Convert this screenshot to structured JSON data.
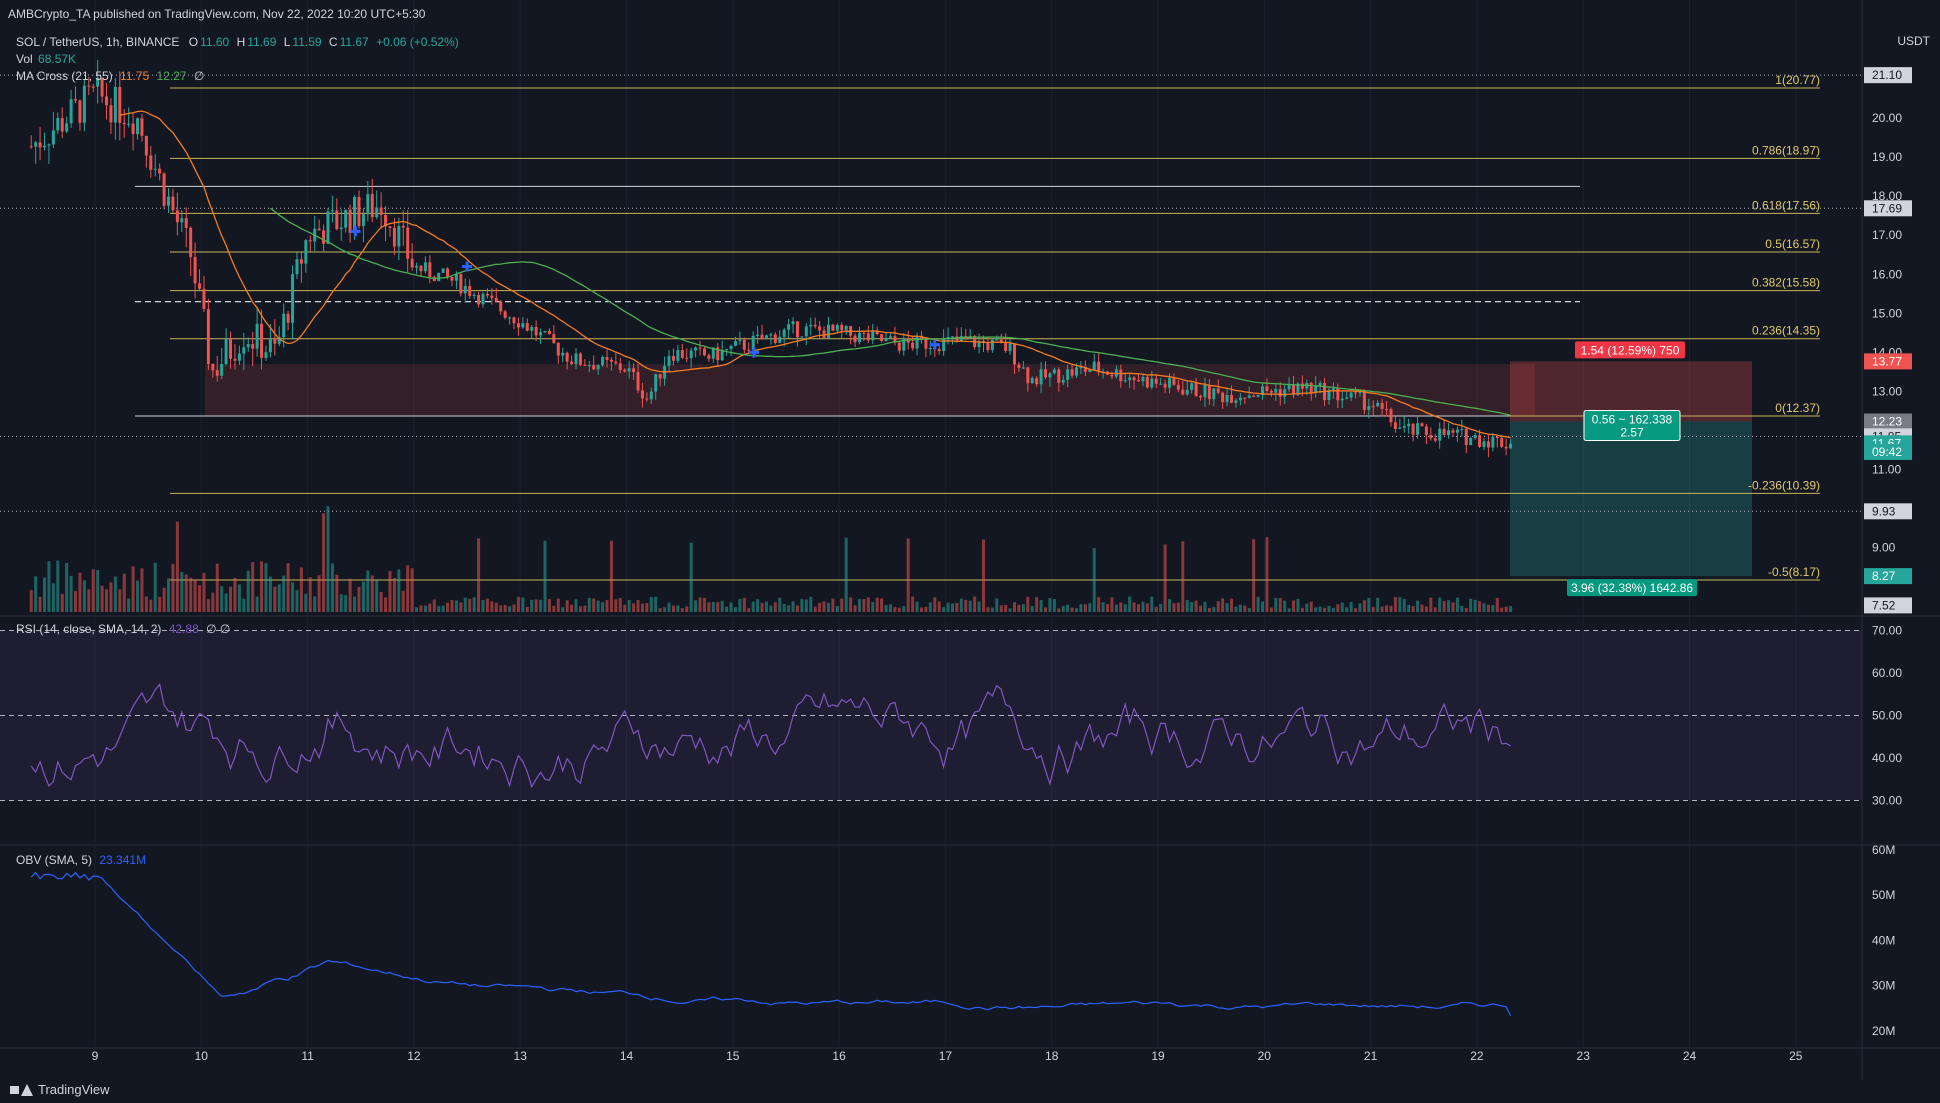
{
  "header": {
    "text": "AMBCrypto_TA published on TradingView.com, Nov 22, 2022 10:20 UTC+5:30"
  },
  "legend": {
    "symbol": "SOL / TetherUS, 1h, BINANCE",
    "o_label": "O",
    "o": "11.60",
    "h_label": "H",
    "h": "11.69",
    "l_label": "L",
    "l": "11.59",
    "c_label": "C",
    "c": "11.67",
    "chg": "+0.06 (+0.52%)",
    "vol_label": "Vol",
    "vol": "68.57K",
    "ma_label": "MA Cross (21, 55)",
    "ma1": "11.75",
    "ma2": "12.27",
    "ma_tail": "∅",
    "rsi_label": "RSI (14, close, SMA, 14, 2)",
    "rsi": "42.88",
    "rsi_tail": "∅ ∅",
    "obv_label": "OBV (SMA, 5)",
    "obv": "23.341M"
  },
  "axis_title": "USDT",
  "footer": {
    "brand": "TradingView"
  },
  "colors": {
    "bg": "#131722",
    "up": "#26a69a",
    "down": "#ef5350",
    "fib": "#c9b458",
    "ma_fast": "#f57c20",
    "ma_slow": "#4caf50",
    "rsi": "#7e57c2",
    "obv": "#2962ff",
    "marker": "#2962ff"
  },
  "chart_data": {
    "type": "candlestick",
    "x_ticks": [
      "9",
      "10",
      "11",
      "12",
      "13",
      "14",
      "15",
      "16",
      "17",
      "18",
      "19",
      "20",
      "21",
      "22",
      "23",
      "24",
      "25"
    ],
    "price_ticks": [
      20.0,
      19.0,
      18.0,
      17.0,
      16.0,
      15.0,
      14.0,
      13.0,
      11.0,
      10.0,
      9.0
    ],
    "price_range": [
      7.3,
      22.0
    ],
    "fib_levels": [
      {
        "ratio": "1",
        "price": 20.77,
        "label": "1(20.77)"
      },
      {
        "ratio": "0.786",
        "price": 18.97,
        "label": "0.786(18.97)"
      },
      {
        "ratio": "0.618",
        "price": 17.56,
        "label": "0.618(17.56)"
      },
      {
        "ratio": "0.5",
        "price": 16.57,
        "label": "0.5(16.57)"
      },
      {
        "ratio": "0.382",
        "price": 15.58,
        "label": "0.382(15.58)"
      },
      {
        "ratio": "0.236",
        "price": 14.35,
        "label": "0.236(14.35)"
      },
      {
        "ratio": "0",
        "price": 12.37,
        "label": "0(12.37)"
      },
      {
        "ratio": "-0.236",
        "price": 10.39,
        "label": "-0.236(10.39)"
      },
      {
        "ratio": "-0.5",
        "price": 8.17,
        "label": "-0.5(8.17)"
      }
    ],
    "price_labels": [
      {
        "text": "21.10",
        "price": 21.1,
        "style": "white"
      },
      {
        "text": "17.69",
        "price": 17.69,
        "style": "white"
      },
      {
        "text": "13.77",
        "price": 13.77,
        "style": "red"
      },
      {
        "text": "12.23",
        "price": 12.23,
        "style": "gray"
      },
      {
        "text": "11.85",
        "price": 11.85,
        "style": "white"
      },
      {
        "text": "11.67",
        "price": 11.67,
        "style": "green"
      },
      {
        "text": "09:42",
        "price": 11.45,
        "style": "green"
      },
      {
        "text": "9.93",
        "price": 9.93,
        "style": "white"
      },
      {
        "text": "8.27",
        "price": 8.27,
        "style": "green"
      },
      {
        "text": "7.52",
        "price": 7.52,
        "style": "white"
      }
    ],
    "position": {
      "entry": 12.23,
      "stop": 13.77,
      "target": 8.27,
      "stop_label": "1.54 (12.59%) 750",
      "entry_label_line1": "0.56 ~ 162.338",
      "entry_label_line2": "2.57",
      "target_label": "3.96 (32.38%) 1642.86"
    },
    "demand_zone": [
      12.37,
      13.7
    ],
    "rsi": {
      "ticks": [
        70.0,
        60.0,
        50.0,
        40.0,
        30.0
      ],
      "range": [
        20,
        72
      ],
      "upper": 70,
      "mid": 50,
      "lower": 30,
      "last": 42.88
    },
    "obv": {
      "ticks": [
        "60M",
        "50M",
        "40M",
        "30M",
        "20M"
      ],
      "range": [
        18,
        60
      ],
      "last": 23.341
    }
  }
}
